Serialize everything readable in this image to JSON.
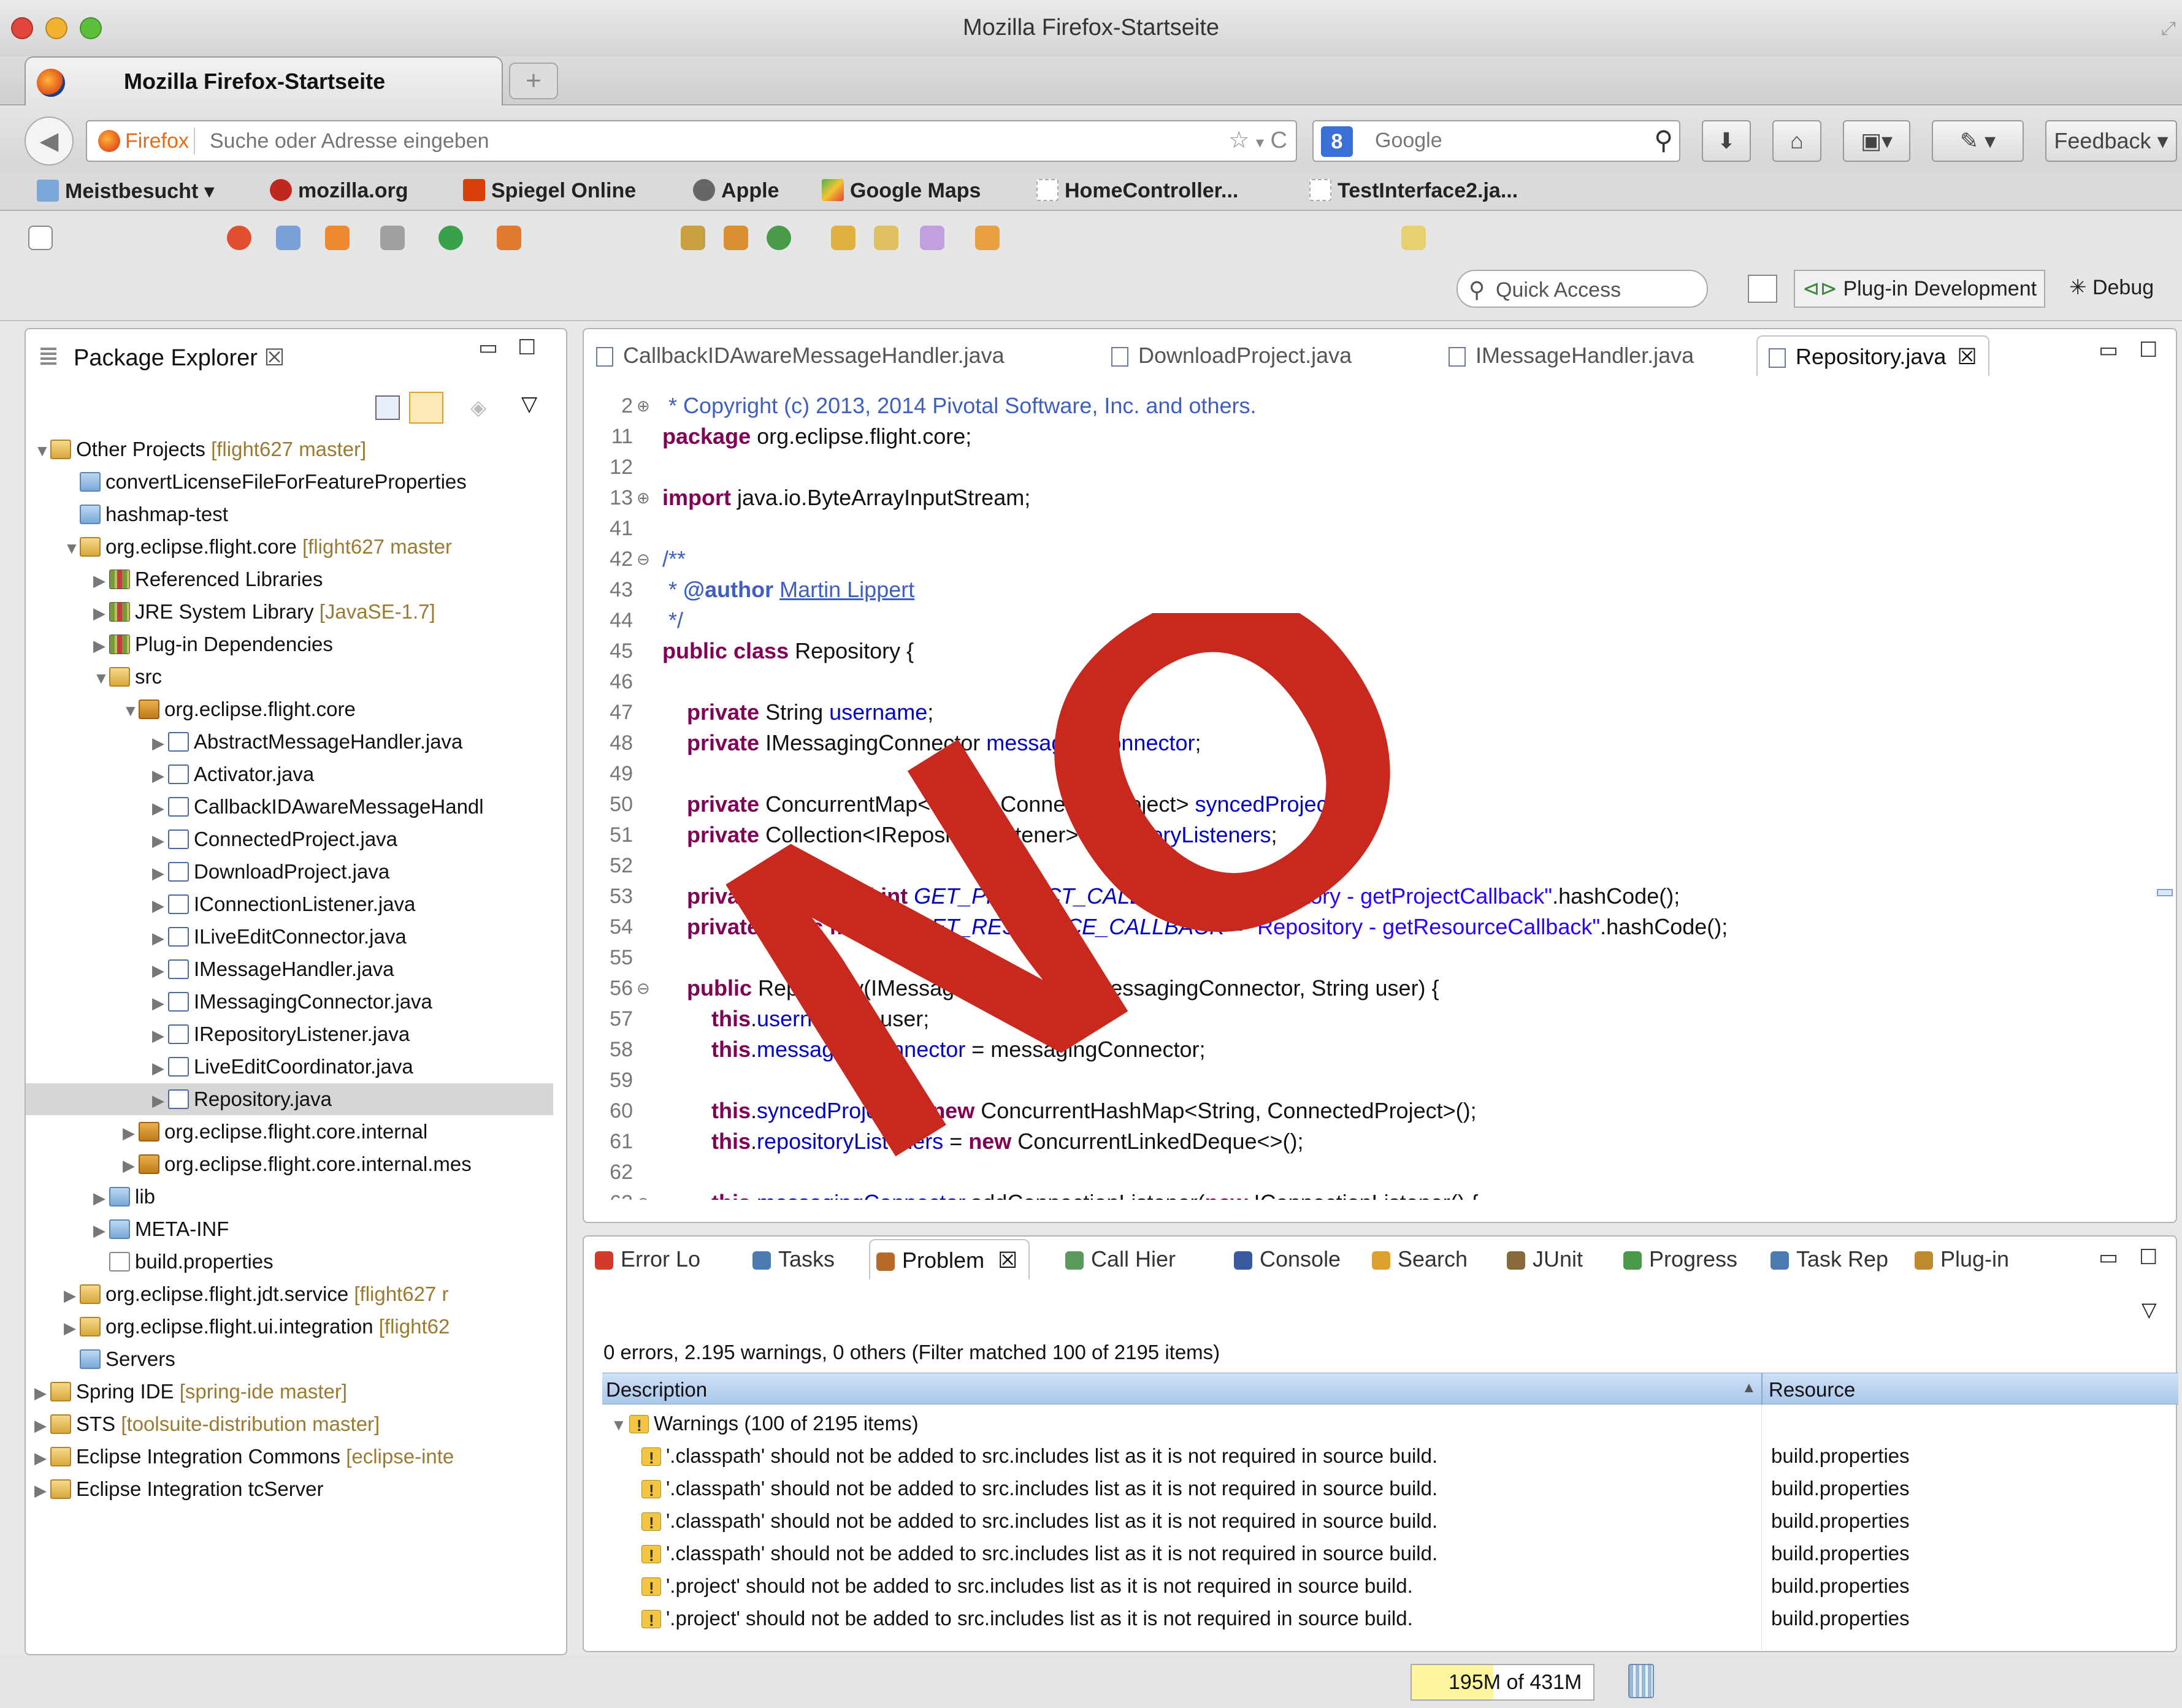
{
  "window": {
    "title": "Mozilla Firefox-Startseite"
  },
  "browser_tab": {
    "label": "Mozilla Firefox-Startseite",
    "new_tab": "+"
  },
  "navbar": {
    "identity": "Firefox",
    "url_placeholder": "Suche oder Adresse eingeben",
    "search_engine": "Google",
    "feedback_label": "Feedback"
  },
  "bookmarks": [
    {
      "label": "Meistbesucht ▾",
      "icon": "folder-icon"
    },
    {
      "label": "mozilla.org",
      "icon": "mozilla-icon"
    },
    {
      "label": "Spiegel Online",
      "icon": "spiegel-icon"
    },
    {
      "label": "Apple",
      "icon": "apple-icon"
    },
    {
      "label": "Google Maps",
      "icon": "maps-icon"
    },
    {
      "label": "HomeController...",
      "icon": "page-icon"
    },
    {
      "label": "TestInterface2.ja...",
      "icon": "page-icon"
    }
  ],
  "eclipse_toolbar": {
    "quick_access": "Quick Access",
    "perspectives": [
      "Plug-in Development",
      "Debug"
    ]
  },
  "package_explorer": {
    "title": "Package Explorer",
    "items": [
      {
        "label": "Other Projects",
        "decoration": " [flight627 master]",
        "level": 0,
        "icon": "project",
        "expanded": true
      },
      {
        "label": "convertLicenseFileForFeatureProperties",
        "decoration": "",
        "level": 1,
        "icon": "folder",
        "expanded": null
      },
      {
        "label": "hashmap-test",
        "decoration": "",
        "level": 1,
        "icon": "folder",
        "expanded": null
      },
      {
        "label": "org.eclipse.flight.core",
        "decoration": " [flight627 master",
        "level": 1,
        "icon": "project",
        "expanded": true
      },
      {
        "label": "Referenced Libraries",
        "decoration": "",
        "level": 2,
        "icon": "lib",
        "expanded": false
      },
      {
        "label": "JRE System Library",
        "decoration": " [JavaSE-1.7]",
        "level": 2,
        "icon": "lib",
        "expanded": false
      },
      {
        "label": "Plug-in Dependencies",
        "decoration": "",
        "level": 2,
        "icon": "lib",
        "expanded": false
      },
      {
        "label": "src",
        "decoration": "",
        "level": 2,
        "icon": "src",
        "expanded": true
      },
      {
        "label": "org.eclipse.flight.core",
        "decoration": "",
        "level": 3,
        "icon": "pkg",
        "expanded": true
      },
      {
        "label": "AbstractMessageHandler.java",
        "decoration": "",
        "level": 4,
        "icon": "java",
        "expanded": false
      },
      {
        "label": "Activator.java",
        "decoration": "",
        "level": 4,
        "icon": "java",
        "expanded": false
      },
      {
        "label": "CallbackIDAwareMessageHandl",
        "decoration": "",
        "level": 4,
        "icon": "java",
        "expanded": false
      },
      {
        "label": "ConnectedProject.java",
        "decoration": "",
        "level": 4,
        "icon": "java",
        "expanded": false
      },
      {
        "label": "DownloadProject.java",
        "decoration": "",
        "level": 4,
        "icon": "java",
        "expanded": false
      },
      {
        "label": "IConnectionListener.java",
        "decoration": "",
        "level": 4,
        "icon": "java",
        "expanded": false
      },
      {
        "label": "ILiveEditConnector.java",
        "decoration": "",
        "level": 4,
        "icon": "java",
        "expanded": false
      },
      {
        "label": "IMessageHandler.java",
        "decoration": "",
        "level": 4,
        "icon": "java",
        "expanded": false
      },
      {
        "label": "IMessagingConnector.java",
        "decoration": "",
        "level": 4,
        "icon": "java",
        "expanded": false
      },
      {
        "label": "IRepositoryListener.java",
        "decoration": "",
        "level": 4,
        "icon": "java",
        "expanded": false
      },
      {
        "label": "LiveEditCoordinator.java",
        "decoration": "",
        "level": 4,
        "icon": "java",
        "expanded": false
      },
      {
        "label": "Repository.java",
        "decoration": "",
        "level": 4,
        "icon": "java",
        "expanded": false,
        "selected": true
      },
      {
        "label": "org.eclipse.flight.core.internal",
        "decoration": "",
        "level": 3,
        "icon": "pkg",
        "expanded": false
      },
      {
        "label": "org.eclipse.flight.core.internal.mes",
        "decoration": "",
        "level": 3,
        "icon": "pkg",
        "expanded": false
      },
      {
        "label": "lib",
        "decoration": "",
        "level": 2,
        "icon": "folder",
        "expanded": false
      },
      {
        "label": "META-INF",
        "decoration": "",
        "level": 2,
        "icon": "folder",
        "expanded": false
      },
      {
        "label": "build.properties",
        "decoration": "",
        "level": 2,
        "icon": "file",
        "expanded": null
      },
      {
        "label": "org.eclipse.flight.jdt.service",
        "decoration": " [flight627 r",
        "level": 1,
        "icon": "project",
        "expanded": false
      },
      {
        "label": "org.eclipse.flight.ui.integration",
        "decoration": " [flight62",
        "level": 1,
        "icon": "project",
        "expanded": false
      },
      {
        "label": "Servers",
        "decoration": "",
        "level": 1,
        "icon": "folder",
        "expanded": null
      },
      {
        "label": "Spring IDE",
        "decoration": " [spring-ide master]",
        "level": 0,
        "icon": "project",
        "expanded": false
      },
      {
        "label": "STS",
        "decoration": " [toolsuite-distribution master]",
        "level": 0,
        "icon": "project",
        "expanded": false
      },
      {
        "label": "Eclipse Integration Commons",
        "decoration": " [eclipse-inte",
        "level": 0,
        "icon": "project",
        "expanded": false
      },
      {
        "label": "Eclipse Integration tcServer",
        "decoration": "",
        "level": 0,
        "icon": "project",
        "expanded": false
      }
    ]
  },
  "editor": {
    "tabs": [
      {
        "label": "CallbackIDAwareMessageHandler.java",
        "active": false
      },
      {
        "label": "DownloadProject.java",
        "active": false
      },
      {
        "label": "IMessageHandler.java",
        "active": false
      },
      {
        "label": "Repository.java",
        "active": true
      }
    ],
    "lines": [
      {
        "n": "2",
        "fold": "⊕",
        "html": "<span class=\"cm\"> * Copyright (c) 2013, 2014 Pivotal Software, Inc. and others.</span>"
      },
      {
        "n": "11",
        "fold": "",
        "html": "<span class=\"kw\">package</span> org.eclipse.flight.core;"
      },
      {
        "n": "12",
        "fold": "",
        "html": ""
      },
      {
        "n": "13",
        "fold": "⊕",
        "html": "<span class=\"kw\">import</span> java.io.ByteArrayInputStream;"
      },
      {
        "n": "41",
        "fold": "",
        "html": ""
      },
      {
        "n": "42",
        "fold": "⊖",
        "html": "<span class=\"cm\">/**</span>"
      },
      {
        "n": "43",
        "fold": "",
        "html": "<span class=\"cm\"> * <b>@author</b> <u>Martin Lippert</u></span>"
      },
      {
        "n": "44",
        "fold": "",
        "html": "<span class=\"cm\"> */</span>"
      },
      {
        "n": "45",
        "fold": "",
        "html": "<span class=\"kw\">public class</span> Repository {"
      },
      {
        "n": "46",
        "fold": "",
        "html": ""
      },
      {
        "n": "47",
        "fold": "",
        "html": "    <span class=\"kw\">private</span> String <span class=\"fld\">username</span>;"
      },
      {
        "n": "48",
        "fold": "",
        "html": "    <span class=\"kw\">private</span> IMessagingConnector <span class=\"fld\">messagingConnector</span>;"
      },
      {
        "n": "49",
        "fold": "",
        "html": ""
      },
      {
        "n": "50",
        "fold": "",
        "html": "    <span class=\"kw\">private</span> ConcurrentMap&lt;String, ConnectedProject&gt; <span class=\"fld\">syncedProjects</span>;"
      },
      {
        "n": "51",
        "fold": "",
        "html": "    <span class=\"kw\">private</span> Collection&lt;IRepositoryListener&gt; <span class=\"fld\">repositoryListeners</span>;"
      },
      {
        "n": "52",
        "fold": "",
        "html": ""
      },
      {
        "n": "53",
        "fold": "",
        "html": "    <span class=\"kw\">private static final int</span> <span class=\"fld ital\">GET_PROJECT_CALLBACK</span> = <span class=\"str\">\"Repository - getProjectCallback\"</span>.hashCode();"
      },
      {
        "n": "54",
        "fold": "",
        "html": "    <span class=\"kw\">private static final int</span> <span class=\"fld ital\">GET_RESOURCE_CALLBACK</span> = <span class=\"str\">\"Repository - getResourceCallback\"</span>.hashCode();"
      },
      {
        "n": "55",
        "fold": "",
        "html": ""
      },
      {
        "n": "56",
        "fold": "⊖",
        "html": "    <span class=\"kw\">public</span> Repository(IMessagingConnector messagingConnector, String user) {"
      },
      {
        "n": "57",
        "fold": "",
        "html": "        <span class=\"kw\">this</span>.<span class=\"fld\">username</span> = user;"
      },
      {
        "n": "58",
        "fold": "",
        "html": "        <span class=\"kw\">this</span>.<span class=\"fld\">messagingConnector</span> = messagingConnector;"
      },
      {
        "n": "59",
        "fold": "",
        "html": ""
      },
      {
        "n": "60",
        "fold": "",
        "html": "        <span class=\"kw\">this</span>.<span class=\"fld\">syncedProjects</span> = <span class=\"kw\">new</span> ConcurrentHashMap&lt;String, ConnectedProject&gt;();"
      },
      {
        "n": "61",
        "fold": "",
        "html": "        <span class=\"kw\">this</span>.<span class=\"fld\">repositoryListeners</span> = <span class=\"kw\">new</span> ConcurrentLinkedDeque&lt;&gt;();"
      },
      {
        "n": "62",
        "fold": "",
        "html": ""
      },
      {
        "n": "63",
        "fold": "⊖",
        "html": "        <span class=\"kw\">this</span>.<span class=\"fld\">messagingConnector</span>.addConnectionListener(<span class=\"kw\">new</span> IConnectionListener() {"
      }
    ]
  },
  "bottom_panel": {
    "tabs": [
      {
        "label": "Error Lo",
        "active": false,
        "color": "#d43a2a"
      },
      {
        "label": "Tasks",
        "active": false,
        "color": "#4a7ab0"
      },
      {
        "label": "Problem",
        "active": true,
        "color": "#b86a2a"
      },
      {
        "label": "Call Hier",
        "active": false,
        "color": "#5a9a5a"
      },
      {
        "label": "Console",
        "active": false,
        "color": "#3a5aa0"
      },
      {
        "label": "Search",
        "active": false,
        "color": "#e0a030"
      },
      {
        "label": "JUnit",
        "active": false,
        "color": "#8a6a3a"
      },
      {
        "label": "Progress",
        "active": false,
        "color": "#4a9a4a"
      },
      {
        "label": "Task Rep",
        "active": false,
        "color": "#4a7ab0"
      },
      {
        "label": "Plug-in",
        "active": false,
        "color": "#c08a30"
      }
    ],
    "summary": "0 errors, 2.195 warnings, 0 others (Filter matched 100 of 2195 items)",
    "col_description": "Description",
    "col_resource": "Resource",
    "group_label": "Warnings (100 of 2195 items)",
    "rows": [
      {
        "description": "'.classpath' should not be added to src.includes list as it is not required in source build.",
        "resource": "build.properties"
      },
      {
        "description": "'.classpath' should not be added to src.includes list as it is not required in source build.",
        "resource": "build.properties"
      },
      {
        "description": "'.classpath' should not be added to src.includes list as it is not required in source build.",
        "resource": "build.properties"
      },
      {
        "description": "'.classpath' should not be added to src.includes list as it is not required in source build.",
        "resource": "build.properties"
      },
      {
        "description": "'.project' should not be added to src.includes list as it is not required in source build.",
        "resource": "build.properties"
      },
      {
        "description": "'.project' should not be added to src.includes list as it is not required in source build.",
        "resource": "build.properties"
      }
    ]
  },
  "status": {
    "heap_used": "195M",
    "heap_total": "of 431M",
    "heap_fraction": 0.45
  },
  "overlay": {
    "text": "NO",
    "color": "#c8281e"
  }
}
